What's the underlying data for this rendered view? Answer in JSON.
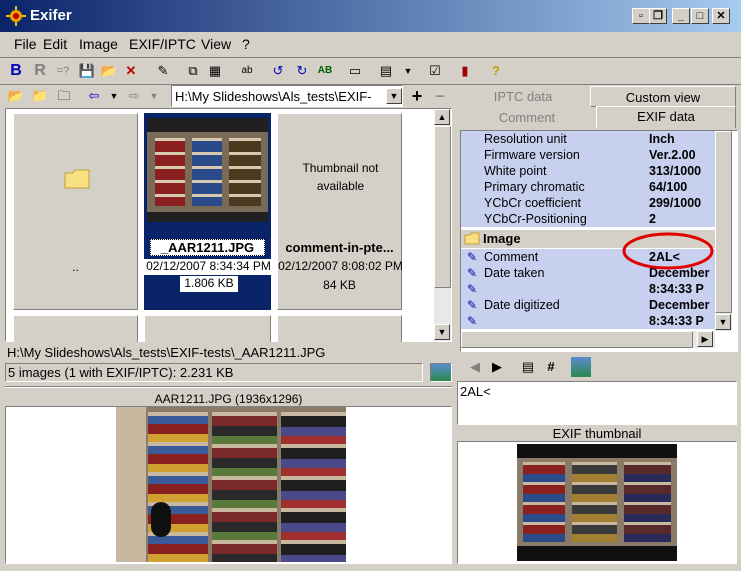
{
  "window": {
    "title": "Exifer"
  },
  "menu": [
    "File",
    "Edit",
    "Image",
    "EXIF/IPTC",
    "View",
    "?"
  ],
  "nav": {
    "path": "H:\\My Slideshows\\Als_tests\\EXIF-"
  },
  "thumbnails": [
    {
      "caption": "..",
      "date": "",
      "size": ""
    },
    {
      "caption": "_AAR1211.JPG",
      "date": "02/12/2007 8:34:34 PM",
      "size": "1.806 KB"
    },
    {
      "caption": "comment-in-pte...",
      "date": "02/12/2007 8:08:02 PM",
      "size": "84 KB",
      "placeholder": "Thumbnail not available"
    }
  ],
  "status": {
    "path": "H:\\My Slideshows\\Als_tests\\EXIF-tests\\_AAR1211.JPG",
    "count": "5 images (1 with EXIF/IPTC): 2.231 KB"
  },
  "preview": {
    "caption": "AAR1211.JPG (1936x1296)"
  },
  "tabs": {
    "iptc": "IPTC data",
    "custom": "Custom view",
    "comment": "Comment",
    "exif": "EXIF data"
  },
  "exif_props": [
    {
      "key": "Resolution unit",
      "value": "Inch"
    },
    {
      "key": "Firmware version",
      "value": "Ver.2.00"
    },
    {
      "key": "White point",
      "value": "313/1000"
    },
    {
      "key": "Primary chromatic",
      "value": "64/100"
    },
    {
      "key": "YCbCr coefficient",
      "value": "299/1000"
    },
    {
      "key": "YCbCr-Positioning",
      "value": "2"
    }
  ],
  "image_group": {
    "label": "Image"
  },
  "image_props": [
    {
      "key": "Comment",
      "value": "2AL<"
    },
    {
      "key": "Date taken",
      "value": "December"
    },
    {
      "key": "",
      "value": "8:34:33 P"
    },
    {
      "key": "Date digitized",
      "value": "December"
    },
    {
      "key": "",
      "value": "8:34:33 P"
    }
  ],
  "comment_box": {
    "text": "2AL<"
  },
  "exif_thumb": {
    "caption": "EXIF thumbnail"
  },
  "colors": {
    "title_start": "#0a246a",
    "title_end": "#a6caf0",
    "selection": "#0a246a",
    "annotation": "#e00000",
    "prop_bg": "#c8d0f0"
  }
}
